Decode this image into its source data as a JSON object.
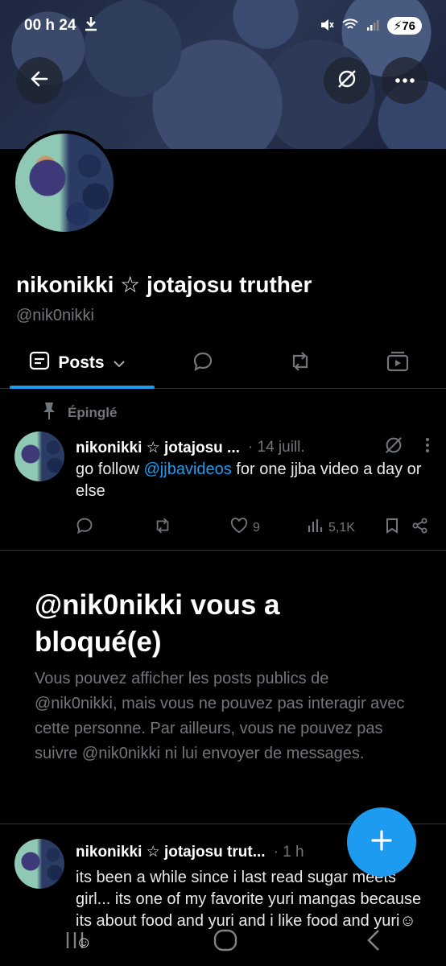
{
  "status_bar": {
    "time": "00 h 24",
    "battery": "76"
  },
  "header": {
    "icons": [
      "back-arrow-icon",
      "grok-icon",
      "more-dots-icon"
    ]
  },
  "profile": {
    "display_name": "nikonikki ☆ jotajosu truther",
    "handle": "@nik0nikki"
  },
  "tabs": [
    {
      "label": "Posts",
      "icon": "posts-icon",
      "active": true
    },
    {
      "icon": "replies-icon"
    },
    {
      "icon": "reposts-icon"
    },
    {
      "icon": "media-icon"
    }
  ],
  "pinned_post": {
    "pinned_label": "Épinglé",
    "author": "nikonikki ☆ jotajosu ...",
    "meta": "· 14 juill.",
    "text_before": "go follow ",
    "mention": "@jjbavideos",
    "text_after": " for one jjba video a day or else",
    "likes": "9",
    "views": "5,1K"
  },
  "blocked": {
    "title": "@nik0nikki vous a bloqué(e)",
    "body": "Vous pouvez afficher les posts publics de @nik0nikki, mais vous ne pouvez pas interagir avec cette personne. Par ailleurs, vous ne pouvez pas suivre @nik0nikki ni lui envoyer de messages."
  },
  "second_post": {
    "author": "nikonikki ☆ jotajosu trut...",
    "meta": "· 1 h",
    "text": "its been a while since i last read sugar meets girl... its one of my favorite yuri mangas because its about food and yuri and i like food and yuri☺☺"
  },
  "colors": {
    "accent": "#1d9bf0",
    "muted": "#71767b",
    "background": "#000000"
  }
}
